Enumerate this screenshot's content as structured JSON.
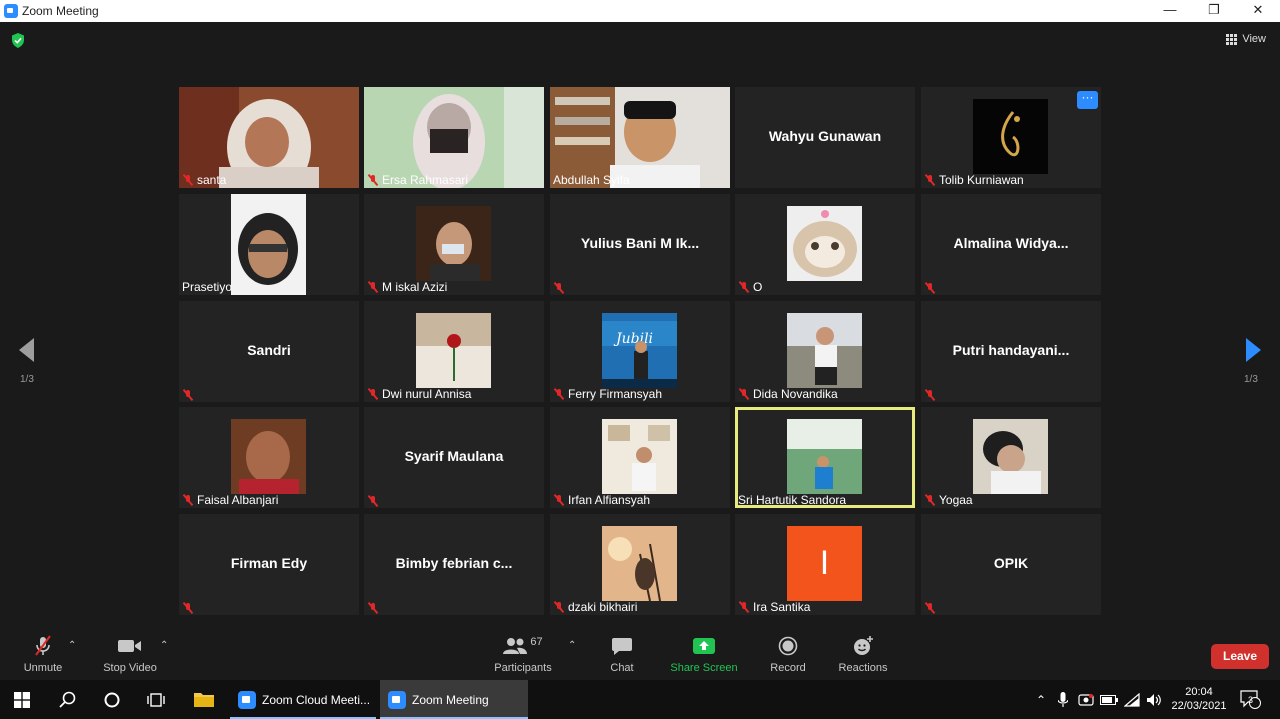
{
  "window": {
    "title": "Zoom Meeting",
    "minimize": "—",
    "restore": "❐",
    "close": "✕"
  },
  "view": {
    "label": "View"
  },
  "pagination": {
    "left": "1/3",
    "right": "1/3"
  },
  "participants": [
    {
      "name": "santa",
      "display": "video",
      "muted": true
    },
    {
      "name": "Ersa Rahmasari",
      "display": "video",
      "muted": true
    },
    {
      "name": "Abdullah Syifa",
      "display": "video",
      "muted": false
    },
    {
      "name": "Wahyu Gunawan",
      "display": "name",
      "muted": false
    },
    {
      "name": "Tolib Kurniawan",
      "display": "avatar",
      "muted": true
    },
    {
      "name": "Prasetiyo",
      "display": "avatar",
      "muted": false
    },
    {
      "name": "M iskal Azizi",
      "display": "avatar",
      "muted": true
    },
    {
      "name": "Yulius Bani M Ik...",
      "display": "name",
      "muted": true
    },
    {
      "name": "O",
      "display": "avatar",
      "muted": true
    },
    {
      "name": "Almalina Widya...",
      "display": "name",
      "muted": true
    },
    {
      "name": "Sandri",
      "display": "name",
      "muted": true
    },
    {
      "name": "Dwi nurul Annisa",
      "display": "avatar",
      "muted": true
    },
    {
      "name": "Ferry Firmansyah",
      "display": "avatar",
      "muted": true
    },
    {
      "name": "Dida Novandika",
      "display": "avatar",
      "muted": true
    },
    {
      "name": "Putri handayani...",
      "display": "name",
      "muted": true
    },
    {
      "name": "Faisal Albanjari",
      "display": "avatar",
      "muted": true
    },
    {
      "name": "Syarif Maulana",
      "display": "name",
      "muted": true
    },
    {
      "name": "Irfan Alfiansyah",
      "display": "avatar",
      "muted": true
    },
    {
      "name": "Sri Hartutik Sandora",
      "display": "avatar",
      "muted": false,
      "active": true
    },
    {
      "name": "Yogaa",
      "display": "avatar",
      "muted": true
    },
    {
      "name": "Firman Edy",
      "display": "name",
      "muted": true
    },
    {
      "name": "Bimby febrian c...",
      "display": "name",
      "muted": true
    },
    {
      "name": "dzaki bikhairi",
      "display": "avatar",
      "muted": true
    },
    {
      "name": "Ira Santika",
      "display": "avatar",
      "muted": true,
      "initial": "I"
    },
    {
      "name": "OPIK",
      "display": "name",
      "muted": true
    }
  ],
  "toolbar": {
    "unmute": "Unmute",
    "stop_video": "Stop Video",
    "participants": "Participants",
    "participant_count": "67",
    "chat": "Chat",
    "share_screen": "Share Screen",
    "record": "Record",
    "reactions": "Reactions",
    "leave": "Leave"
  },
  "colors": {
    "accent": "#2d8cff",
    "share": "#21c453",
    "leave": "#d0312d",
    "active_speaker": "#e7ea7c",
    "muted": "#e02828"
  },
  "taskbar": {
    "apps": [
      {
        "label": "Zoom Cloud Meeti..."
      },
      {
        "label": "Zoom Meeting"
      }
    ],
    "time": "20:04",
    "date": "22/03/2021",
    "notifications": "3"
  }
}
